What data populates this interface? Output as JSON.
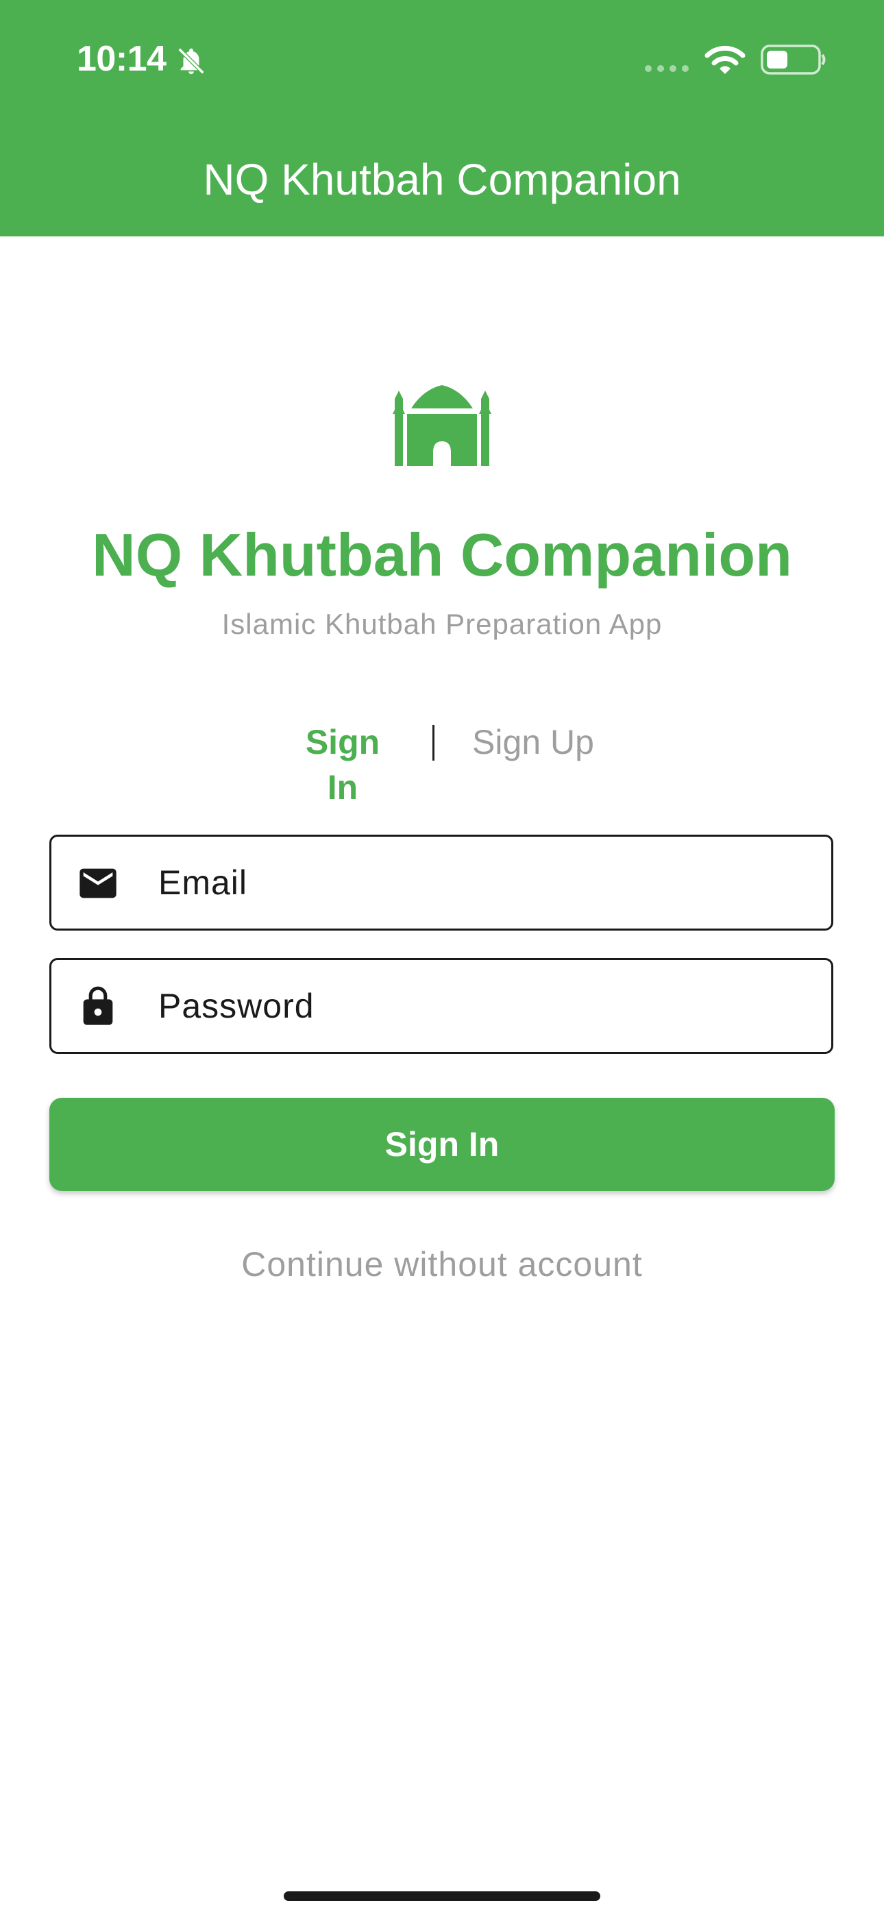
{
  "status_bar": {
    "time": "10:14",
    "icons": [
      "bell-off-icon",
      "cellular-signal-icon",
      "wifi-icon",
      "battery-icon"
    ]
  },
  "app_bar": {
    "title": "NQ Khutbah Companion",
    "background_color": "#4caf50"
  },
  "hero": {
    "icon": "mosque-icon",
    "title": "NQ Khutbah Companion",
    "subtitle": "Islamic Khutbah Preparation App"
  },
  "auth_tabs": {
    "sign_in": "Sign In",
    "sign_up": "Sign Up",
    "active": "Sign In"
  },
  "form": {
    "email": {
      "placeholder": "Email",
      "icon": "mail-icon"
    },
    "password": {
      "placeholder": "Password",
      "icon": "lock-icon"
    },
    "submit_label": "Sign In"
  },
  "guest_link": "Continue without account",
  "colors": {
    "accent": "#4caf50",
    "muted_text": "#9e9e9e",
    "dark_text": "#1a1a1a"
  }
}
